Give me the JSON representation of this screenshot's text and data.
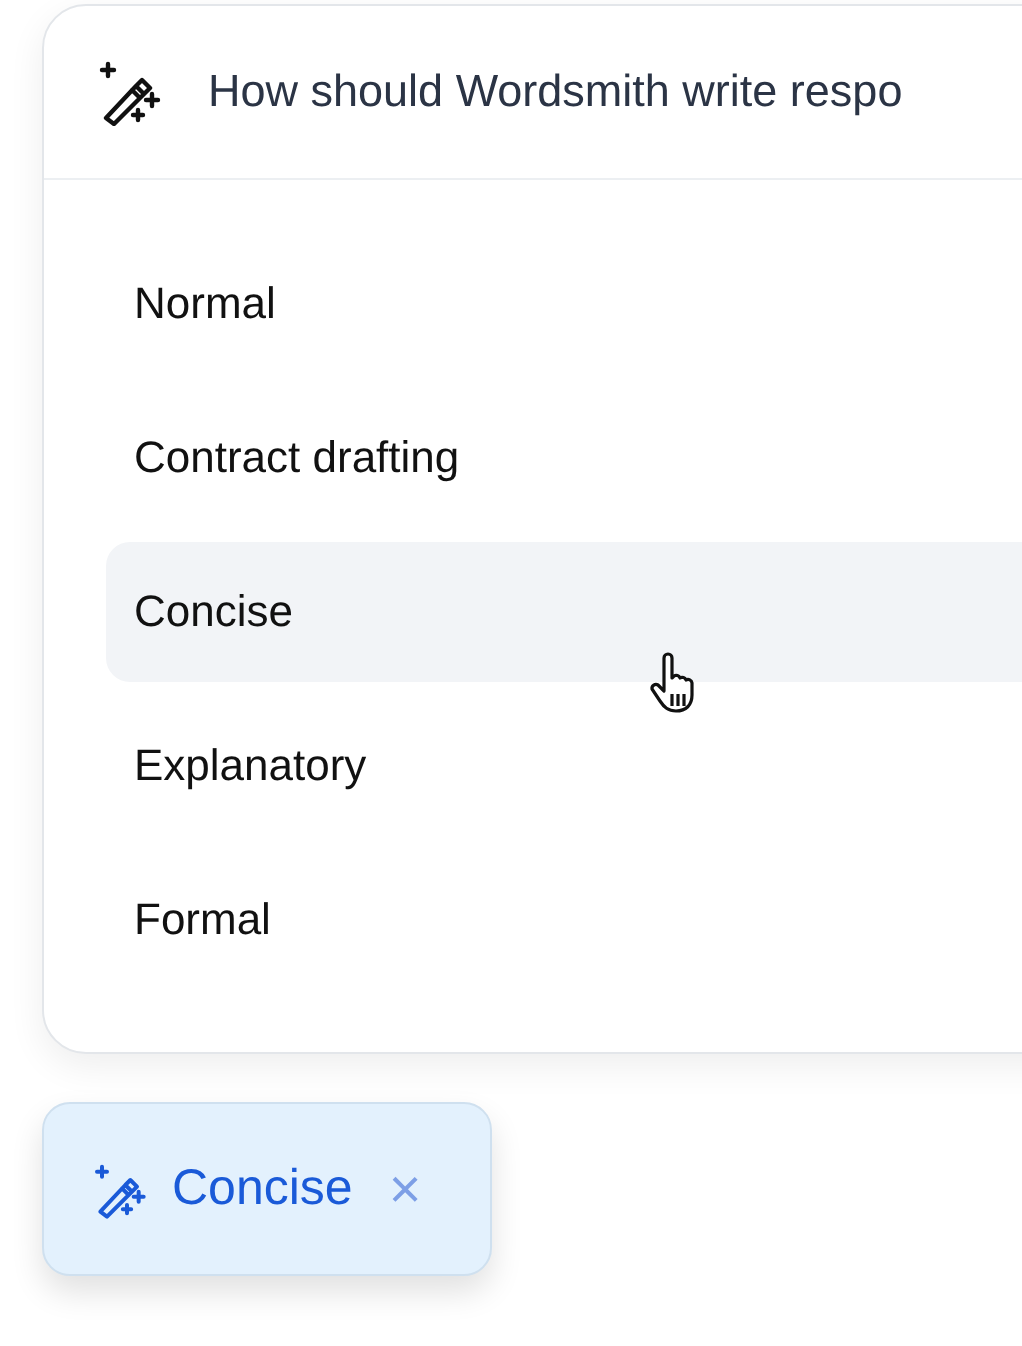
{
  "prompt": {
    "title": "How should Wordsmith write respo"
  },
  "options": [
    {
      "label": "Normal",
      "hovered": false
    },
    {
      "label": "Contract drafting",
      "hovered": false
    },
    {
      "label": "Concise",
      "hovered": true
    },
    {
      "label": "Explanatory",
      "hovered": false
    },
    {
      "label": "Formal",
      "hovered": false
    }
  ],
  "chip": {
    "label": "Concise",
    "close": "×"
  }
}
